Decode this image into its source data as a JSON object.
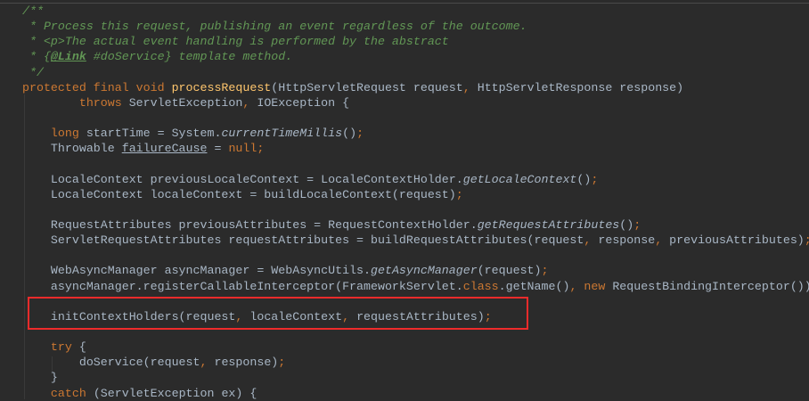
{
  "colors": {
    "background": "#2b2b2b",
    "keyword": "#cc7832",
    "comment": "#629755",
    "method": "#ffc66d",
    "text": "#a9b7c6",
    "highlight": "#ee2b2b"
  },
  "lines": [
    [
      [
        "c",
        "/**"
      ]
    ],
    [
      [
        "c",
        " * Process this request, publishing an event regardless of the outcome."
      ]
    ],
    [
      [
        "c",
        " * <p>The actual event handling is performed by the abstract"
      ]
    ],
    [
      [
        "c",
        " * {"
      ],
      [
        "tag",
        "@Link"
      ],
      [
        "c",
        " #doService} template method."
      ]
    ],
    [
      [
        "c",
        " */"
      ]
    ],
    [
      [
        "k",
        "protected final void "
      ],
      [
        "m",
        "processRequest"
      ],
      [
        "t",
        "(HttpServletRequest request"
      ],
      [
        "k",
        ", "
      ],
      [
        "t",
        "HttpServletResponse response)"
      ]
    ],
    [
      [
        "t",
        "        "
      ],
      [
        "k",
        "throws "
      ],
      [
        "t",
        "ServletException"
      ],
      [
        "k",
        ", "
      ],
      [
        "t",
        "IOException {"
      ]
    ],
    [],
    [
      [
        "t",
        "    "
      ],
      [
        "k",
        "long "
      ],
      [
        "t",
        "startTime = System."
      ],
      [
        "i",
        "currentTimeMillis"
      ],
      [
        "t",
        "()"
      ],
      [
        "k",
        ";"
      ]
    ],
    [
      [
        "t",
        "    Throwable "
      ],
      [
        "u",
        "failureCause"
      ],
      [
        "t",
        " = "
      ],
      [
        "k",
        "null;"
      ]
    ],
    [],
    [
      [
        "t",
        "    LocaleContext previousLocaleContext = LocaleContextHolder."
      ],
      [
        "i",
        "getLocaleContext"
      ],
      [
        "t",
        "()"
      ],
      [
        "k",
        ";"
      ]
    ],
    [
      [
        "t",
        "    LocaleContext localeContext = buildLocaleContext(request)"
      ],
      [
        "k",
        ";"
      ]
    ],
    [],
    [
      [
        "t",
        "    RequestAttributes previousAttributes = RequestContextHolder."
      ],
      [
        "i",
        "getRequestAttributes"
      ],
      [
        "t",
        "()"
      ],
      [
        "k",
        ";"
      ]
    ],
    [
      [
        "t",
        "    ServletRequestAttributes requestAttributes = buildRequestAttributes(request"
      ],
      [
        "k",
        ", "
      ],
      [
        "t",
        "response"
      ],
      [
        "k",
        ", "
      ],
      [
        "t",
        "previousAttributes)"
      ],
      [
        "k",
        ";"
      ]
    ],
    [],
    [
      [
        "t",
        "    WebAsyncManager asyncManager = WebAsyncUtils."
      ],
      [
        "i",
        "getAsyncManager"
      ],
      [
        "t",
        "(request)"
      ],
      [
        "k",
        ";"
      ]
    ],
    [
      [
        "t",
        "    asyncManager.registerCallableInterceptor(FrameworkServlet."
      ],
      [
        "k",
        "class"
      ],
      [
        "t",
        ".getName()"
      ],
      [
        "k",
        ", new "
      ],
      [
        "t",
        "RequestBindingInterceptor())"
      ],
      [
        "k",
        ";"
      ]
    ],
    [],
    [
      [
        "t",
        "    initContextHolders(request"
      ],
      [
        "k",
        ", "
      ],
      [
        "t",
        "localeContext"
      ],
      [
        "k",
        ", "
      ],
      [
        "t",
        "requestAttributes)"
      ],
      [
        "k",
        ";"
      ]
    ],
    [],
    [
      [
        "t",
        "    "
      ],
      [
        "k",
        "try "
      ],
      [
        "t",
        "{"
      ]
    ],
    [
      [
        "t",
        "        doService(request"
      ],
      [
        "k",
        ", "
      ],
      [
        "t",
        "response)"
      ],
      [
        "k",
        ";"
      ]
    ],
    [
      [
        "t",
        "    }"
      ]
    ],
    [
      [
        "t",
        "    "
      ],
      [
        "k",
        "catch "
      ],
      [
        "t",
        "(ServletException ex) {"
      ]
    ]
  ]
}
